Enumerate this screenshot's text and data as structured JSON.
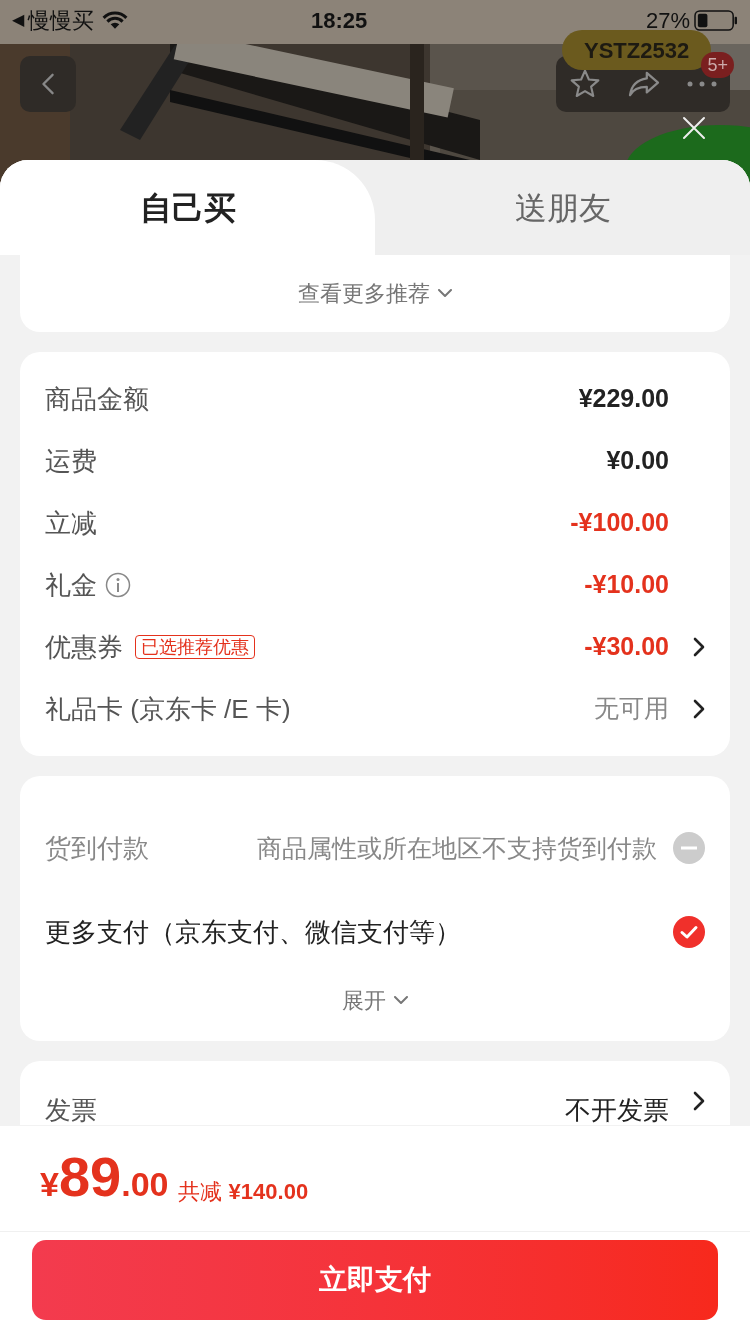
{
  "status_bar": {
    "back_arrow": "◀",
    "back_app": "慢慢买",
    "time": "18:25",
    "battery": "27%"
  },
  "header": {
    "code_badge": "YSTZ2532",
    "notification_count": "5+"
  },
  "tabs": [
    {
      "label": "自己买",
      "selected": true
    },
    {
      "label": "送朋友",
      "selected": false
    }
  ],
  "recommend": {
    "label": "查看更多推荐"
  },
  "price_rows": [
    {
      "label": "商品金额",
      "value": "¥229.00",
      "kind": "plain",
      "info": false,
      "chevron": false
    },
    {
      "label": "运费",
      "value": "¥0.00",
      "kind": "plain",
      "info": false,
      "chevron": false
    },
    {
      "label": "立减",
      "value": "-¥100.00",
      "kind": "discount",
      "info": false,
      "chevron": false
    },
    {
      "label": "礼金",
      "value": "-¥10.00",
      "kind": "discount",
      "info": true,
      "chevron": false
    },
    {
      "label": "优惠券",
      "badge": "已选推荐优惠",
      "value": "-¥30.00",
      "kind": "discount",
      "info": false,
      "chevron": true
    },
    {
      "label": "礼品卡 (京东卡 /E 卡)",
      "value": "无可用",
      "kind": "muted",
      "info": false,
      "chevron": true
    }
  ],
  "payment_options": [
    {
      "label": "货到付款",
      "note": "商品属性或所在地区不支持货到付款",
      "selected": false,
      "disabled": true
    },
    {
      "label": "更多支付（京东支付、微信支付等）",
      "selected": true,
      "disabled": false
    }
  ],
  "expand": {
    "label": "展开"
  },
  "invoice": {
    "label": "发票",
    "value": "不开发票"
  },
  "footer": {
    "currency": "¥",
    "integer": "89",
    "decimals": ".00",
    "savings_label": "共减",
    "savings": "¥140.00"
  },
  "pay_button": {
    "label": "立即支付"
  }
}
